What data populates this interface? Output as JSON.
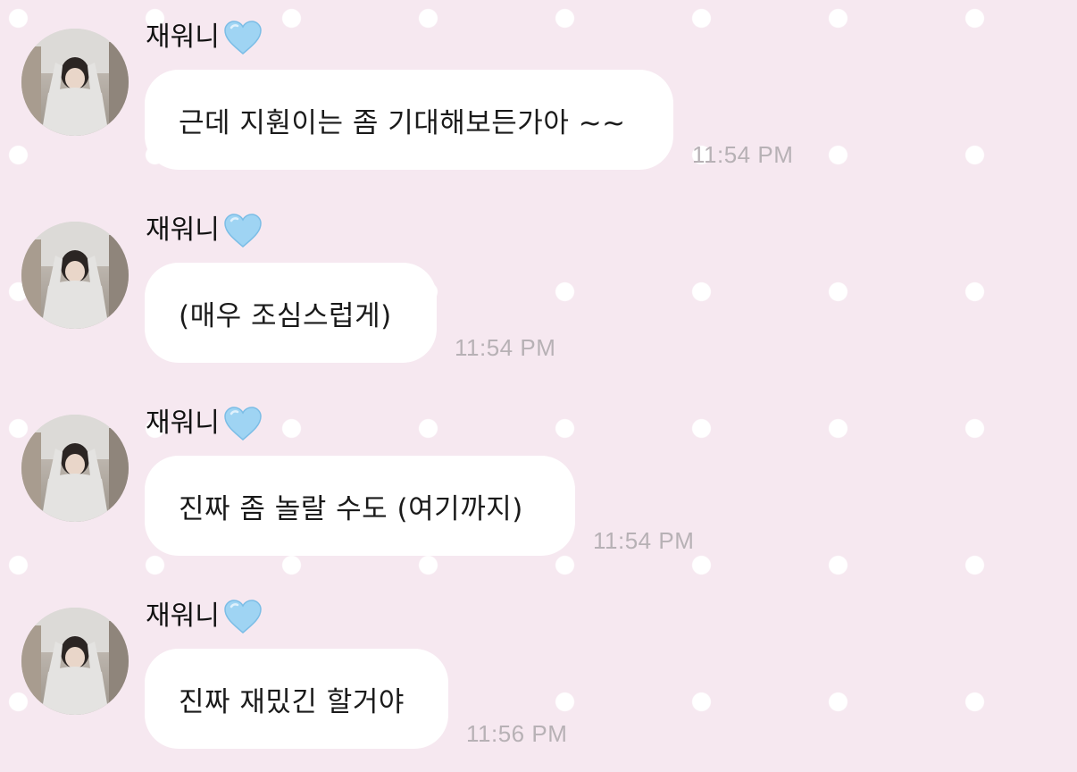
{
  "messages": [
    {
      "sender": "재워니",
      "text": "근데 지훤이는 좀 기대해보든가아 ~~",
      "time": "11:54 PM"
    },
    {
      "sender": "재워니",
      "text": "(매우 조심스럽게)",
      "time": "11:54 PM"
    },
    {
      "sender": "재워니",
      "text": "진짜 좀 놀랄 수도 (여기까지)",
      "time": "11:54 PM"
    },
    {
      "sender": "재워니",
      "text": "진짜 재밌긴 할거야",
      "time": "11:56 PM"
    }
  ],
  "icons": {
    "sender_badge": "light-blue-heart-icon",
    "avatar": "profile-photo"
  },
  "colors": {
    "background": "#f6e8f0",
    "dots": "#ffffff",
    "bubble": "#ffffff",
    "heart": "#9fd4f3",
    "timestamp": "#b7b1b5"
  }
}
